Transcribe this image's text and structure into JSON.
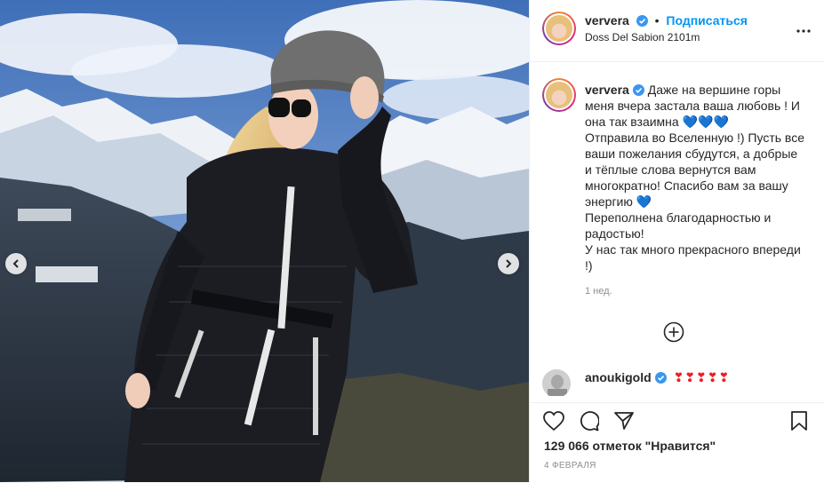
{
  "post": {
    "username": "ververa",
    "follow_label": "Подписаться",
    "dot": "•",
    "location": "Doss Del Sabion 2101m"
  },
  "caption": {
    "username": "ververa",
    "lines": [
      "Даже на вершине горы меня вчера застала ваша любовь ! И она так взаимна",
      "Отправила во Вселенную !) Пусть все ваши пожелания сбудутся, а добрые и тёплые слова вернутся вам многократно! Спасибо вам за вашу энергию",
      "Переполнена благодарностью и радостью!",
      "У нас так много прекрасного впереди !)"
    ],
    "hearts_line1": "💙💙💙",
    "hearts_line2": "💙",
    "time_ago": "1 нед."
  },
  "comment": {
    "username": "anoukigold",
    "text": "❣❣❣❣❣"
  },
  "stats": {
    "likes": "129 066 отметок \"Нравится\"",
    "date": "4 ФЕВРАЛЯ"
  },
  "icons": {
    "verified": "verified-badge-icon",
    "more": "more-options-icon",
    "prev": "chevron-left-icon",
    "next": "chevron-right-icon",
    "like": "heart-icon",
    "comment": "comment-icon",
    "share": "share-icon",
    "save": "bookmark-icon",
    "load_more": "plus-circle-icon"
  },
  "colors": {
    "accent": "#0095f6",
    "verified": "#3897f0",
    "blue_heart": "#1d77d8",
    "red_heart": "#ed1c24"
  }
}
